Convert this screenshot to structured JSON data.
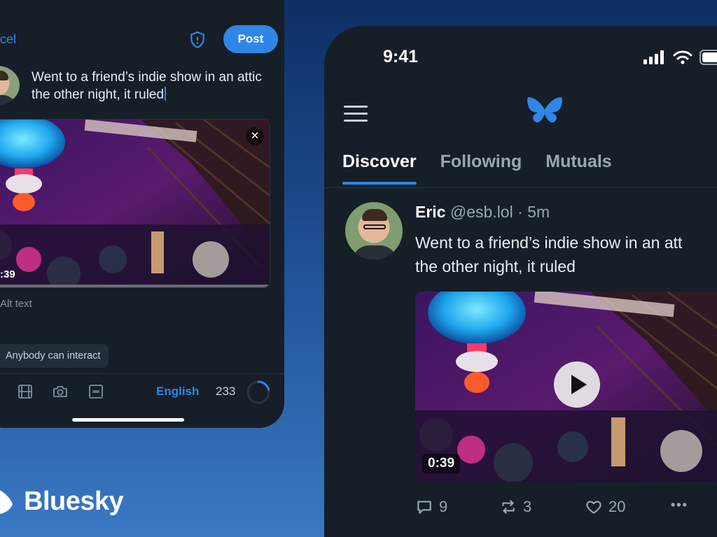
{
  "composer": {
    "cancel_label": "ncel",
    "post_label": "Post",
    "text": "Went to a friend’s indie show in an attic the other night, it ruled",
    "media_duration": ":39",
    "close_label": "✕",
    "alt_text_label": "Alt text",
    "interaction_setting": "Anybody can interact",
    "language": "English",
    "chars_remaining": "233",
    "icons": [
      "video-icon",
      "camera-icon",
      "gif-icon"
    ]
  },
  "brand": {
    "name": "Bluesky",
    "color": "#2e86e8"
  },
  "feed": {
    "status_time": "9:41",
    "tabs": [
      {
        "label": "Discover",
        "active": true
      },
      {
        "label": "Following",
        "active": false
      },
      {
        "label": "Mutuals",
        "active": false
      }
    ],
    "post": {
      "author": "Eric",
      "handle": "@esb.lol",
      "separator": "·",
      "ago": "5m",
      "text_line1": "Went to a friend’s indie show in an att",
      "text_line2": "the other night, it ruled",
      "video_duration": "0:39",
      "replies": "9",
      "reposts": "3",
      "likes": "20",
      "more_label": "•••"
    }
  }
}
